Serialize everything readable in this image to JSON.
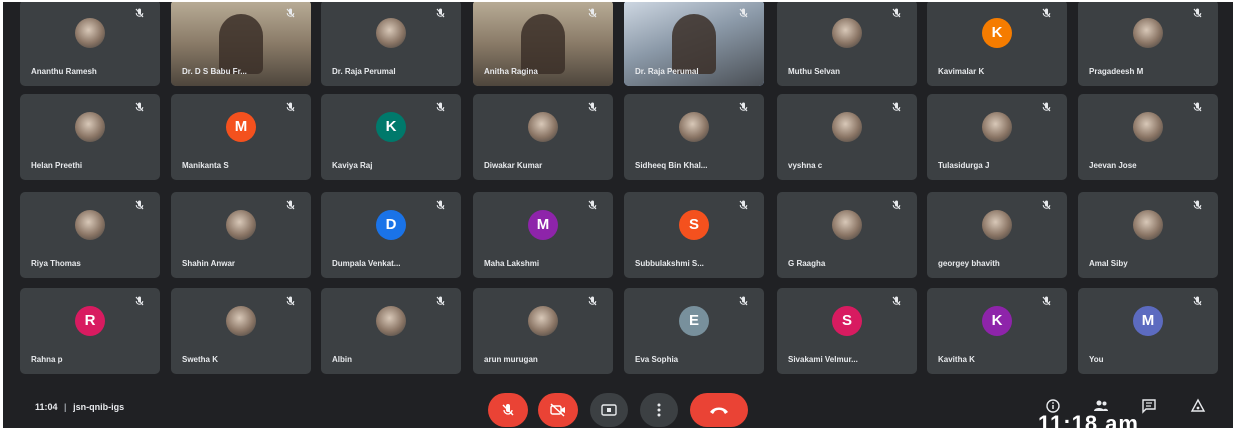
{
  "meeting": {
    "time": "11:04",
    "separator": "|",
    "code": "jsn-qnib-igs",
    "clock": "11:18 am"
  },
  "colors": {
    "background": "#202124",
    "tile": "#3c4043",
    "end_call": "#ea4335",
    "muted_button": "#ea4335",
    "active_speaker_outline": "#8ab4f8"
  },
  "participants": [
    {
      "name": "Ananthu Ramesh",
      "avatar": "photo",
      "initial": ""
    },
    {
      "name": "Dr. D S Babu Fr...",
      "avatar": "video",
      "initial": ""
    },
    {
      "name": "Dr. Raja Perumal",
      "avatar": "photo",
      "initial": ""
    },
    {
      "name": "Anitha Ragina",
      "avatar": "video",
      "initial": ""
    },
    {
      "name": "Dr. Raja Perumal",
      "avatar": "video-active",
      "initial": ""
    },
    {
      "name": "Muthu Selvan",
      "avatar": "photo",
      "initial": ""
    },
    {
      "name": "Kavimalar K",
      "avatar": "letter",
      "initial": "K",
      "color": "#f57c00"
    },
    {
      "name": "Pragadeesh M",
      "avatar": "photo",
      "initial": ""
    },
    {
      "name": "Helan Preethi",
      "avatar": "photo",
      "initial": ""
    },
    {
      "name": "Manikanta S",
      "avatar": "letter",
      "initial": "M",
      "color": "#f4511e"
    },
    {
      "name": "Kaviya Raj",
      "avatar": "letter",
      "initial": "K",
      "color": "#00796b"
    },
    {
      "name": "Diwakar Kumar",
      "avatar": "photo",
      "initial": ""
    },
    {
      "name": "Sidheeq Bin Khal...",
      "avatar": "photo",
      "initial": ""
    },
    {
      "name": "vyshna c",
      "avatar": "photo",
      "initial": ""
    },
    {
      "name": "Tulasidurga J",
      "avatar": "photo",
      "initial": ""
    },
    {
      "name": "Jeevan Jose",
      "avatar": "photo",
      "initial": ""
    },
    {
      "name": "Riya Thomas",
      "avatar": "photo",
      "initial": ""
    },
    {
      "name": "Shahin Anwar",
      "avatar": "photo",
      "initial": ""
    },
    {
      "name": "Dumpala Venkat...",
      "avatar": "letter",
      "initial": "D",
      "color": "#1a73e8"
    },
    {
      "name": "Maha Lakshmi",
      "avatar": "letter",
      "initial": "M",
      "color": "#8e24aa"
    },
    {
      "name": "Subbulakshmi S...",
      "avatar": "letter",
      "initial": "S",
      "color": "#f4511e"
    },
    {
      "name": "G Raagha",
      "avatar": "photo",
      "initial": ""
    },
    {
      "name": "georgey bhavith",
      "avatar": "photo",
      "initial": ""
    },
    {
      "name": "Amal Siby",
      "avatar": "photo",
      "initial": ""
    },
    {
      "name": "Rahna p",
      "avatar": "letter",
      "initial": "R",
      "color": "#d81b60"
    },
    {
      "name": "Swetha K",
      "avatar": "photo",
      "initial": ""
    },
    {
      "name": "Albin",
      "avatar": "photo",
      "initial": ""
    },
    {
      "name": "arun murugan",
      "avatar": "photo",
      "initial": ""
    },
    {
      "name": "Eva Sophia",
      "avatar": "letter",
      "initial": "E",
      "color": "#78909c"
    },
    {
      "name": "Sivakami Velmur...",
      "avatar": "letter",
      "initial": "S",
      "color": "#d81b60"
    },
    {
      "name": "Kavitha K",
      "avatar": "letter",
      "initial": "K",
      "color": "#8e24aa"
    },
    {
      "name": "You",
      "avatar": "letter",
      "initial": "M",
      "color": "#5c6bc0"
    }
  ],
  "controls": [
    {
      "icon": "mic-off-icon",
      "style": "red"
    },
    {
      "icon": "camera-off-icon",
      "style": "red"
    },
    {
      "icon": "present-screen-icon",
      "style": "grey"
    },
    {
      "icon": "more-options-icon",
      "style": "grey"
    },
    {
      "icon": "end-call-icon",
      "style": "red"
    }
  ],
  "right_icons": [
    "info-icon",
    "people-icon",
    "chat-icon",
    "activities-icon"
  ]
}
